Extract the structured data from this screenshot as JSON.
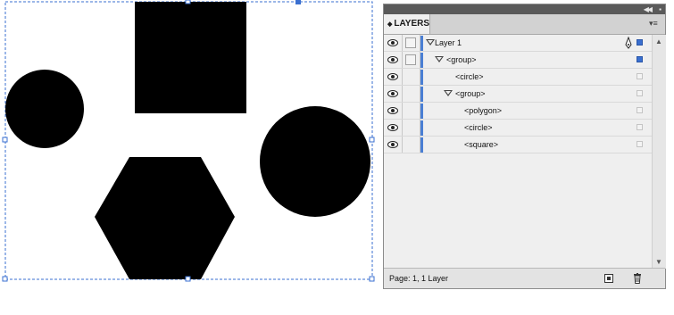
{
  "panel": {
    "tab_label": "LAYERS",
    "tab_icon": "double-arrow-icon",
    "collapse_icon": "double-chevron-left-icon",
    "close_icon": "close-icon",
    "menu_icon": "panel-menu-icon",
    "status": "Page: 1, 1 Layer",
    "new_layer_icon": "new-layer-icon",
    "delete_icon": "trash-icon"
  },
  "layers": [
    {
      "label": "Layer 1",
      "expanded": true,
      "visible": true,
      "selected_target": true
    },
    {
      "label": "<group>",
      "expanded": true,
      "visible": true,
      "selected_target": true
    },
    {
      "label": "<circle>",
      "visible": true,
      "selected_target": false
    },
    {
      "label": "<group>",
      "expanded": true,
      "visible": true,
      "selected_target": false
    },
    {
      "label": "<polygon>",
      "visible": true,
      "selected_target": false
    },
    {
      "label": "<circle>",
      "visible": true,
      "selected_target": false
    },
    {
      "label": "<square>",
      "visible": true,
      "selected_target": false
    }
  ],
  "colors": {
    "layer_color": "#4a7fd4",
    "selection": "#3a6fd0",
    "shape_fill": "#000000"
  }
}
